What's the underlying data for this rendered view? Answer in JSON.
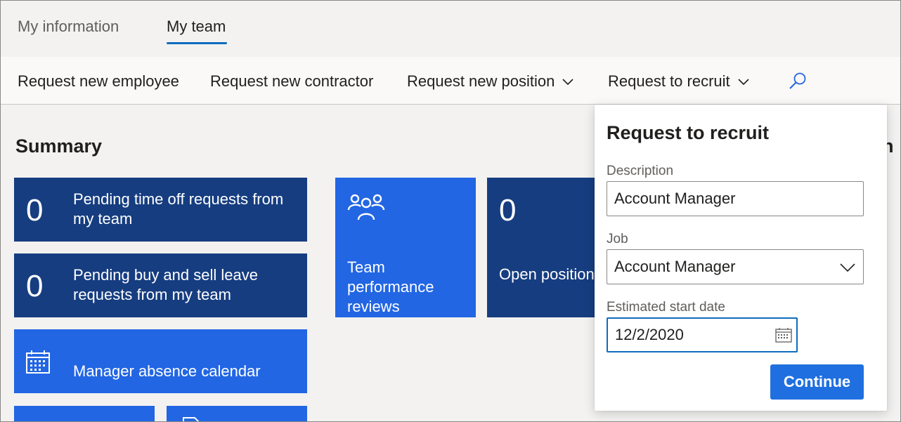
{
  "tabs": {
    "my_information": "My information",
    "my_team": "My team"
  },
  "actions": {
    "request_new_employee": "Request new employee",
    "request_new_contractor": "Request new contractor",
    "request_new_position": "Request new position",
    "request_to_recruit": "Request to recruit"
  },
  "summary": {
    "title": "Summary",
    "tiles": {
      "pending_time_off": {
        "count": "0",
        "label": "Pending time off requests from my team"
      },
      "pending_buy_sell": {
        "count": "0",
        "label": "Pending buy and sell leave requests from my team"
      },
      "absence_calendar": {
        "label": "Manager absence calendar"
      },
      "team_reviews": {
        "label": "Team performance reviews"
      },
      "open_positions": {
        "count": "0",
        "label": "Open positions - Direct reports"
      }
    },
    "right_peek": "n"
  },
  "flyout": {
    "title": "Request to recruit",
    "description_label": "Description",
    "description_value": "Account Manager",
    "job_label": "Job",
    "job_value": "Account Manager",
    "start_date_label": "Estimated start date",
    "start_date_value": "12/2/2020",
    "continue_label": "Continue"
  },
  "colors": {
    "accent": "#0f6cbd",
    "tile_dark": "#163d80",
    "tile_bright": "#2266e3",
    "button": "#1f6fe0"
  },
  "icons": {
    "search": "search-icon",
    "chevron": "chevron-down-icon",
    "calendar": "calendar-icon",
    "people": "people-icon",
    "document": "document-icon"
  }
}
